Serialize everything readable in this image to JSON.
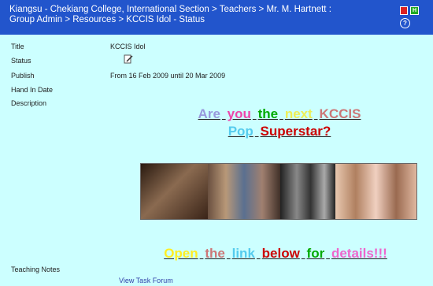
{
  "header": {
    "breadcrumb_line1": "Kiangsu - Chekiang College, International Section > Teachers > Mr. M. Hartnett :",
    "breadcrumb_line2": "Group Admin > Resources > KCCIS Idol - Status",
    "icon_green_letter": "H",
    "help_glyph": "?"
  },
  "fields": {
    "title_label": "Title",
    "title_value": "KCCIS Idol",
    "status_label": "Status",
    "publish_label": "Publish",
    "publish_value": "From 16 Feb 2009 until 20 Mar 2009",
    "handin_label": "Hand In Date",
    "description_label": "Description",
    "teaching_notes_label": "Teaching Notes"
  },
  "description": {
    "line1": [
      "Are",
      "you",
      "the",
      "next",
      "KCCIS"
    ],
    "line2": [
      "Pop",
      "Superstar?"
    ],
    "line3": [
      "Open",
      "the",
      "link",
      "below",
      "for",
      "details!!!"
    ]
  },
  "colors": {
    "header_bg": "#2255cc",
    "page_bg": "#ccffff",
    "line1": [
      "#9999dd",
      "#ee44aa",
      "#00aa00",
      "#eeee55",
      "#cc7777"
    ],
    "line2": [
      "#55ccee",
      "#cc0000"
    ],
    "line3": [
      "#ffee22",
      "#cc7777",
      "#55ccee",
      "#cc0000",
      "#00aa00",
      "#ee66cc"
    ]
  },
  "links": {
    "view_task_forum": "View Task Forum"
  }
}
